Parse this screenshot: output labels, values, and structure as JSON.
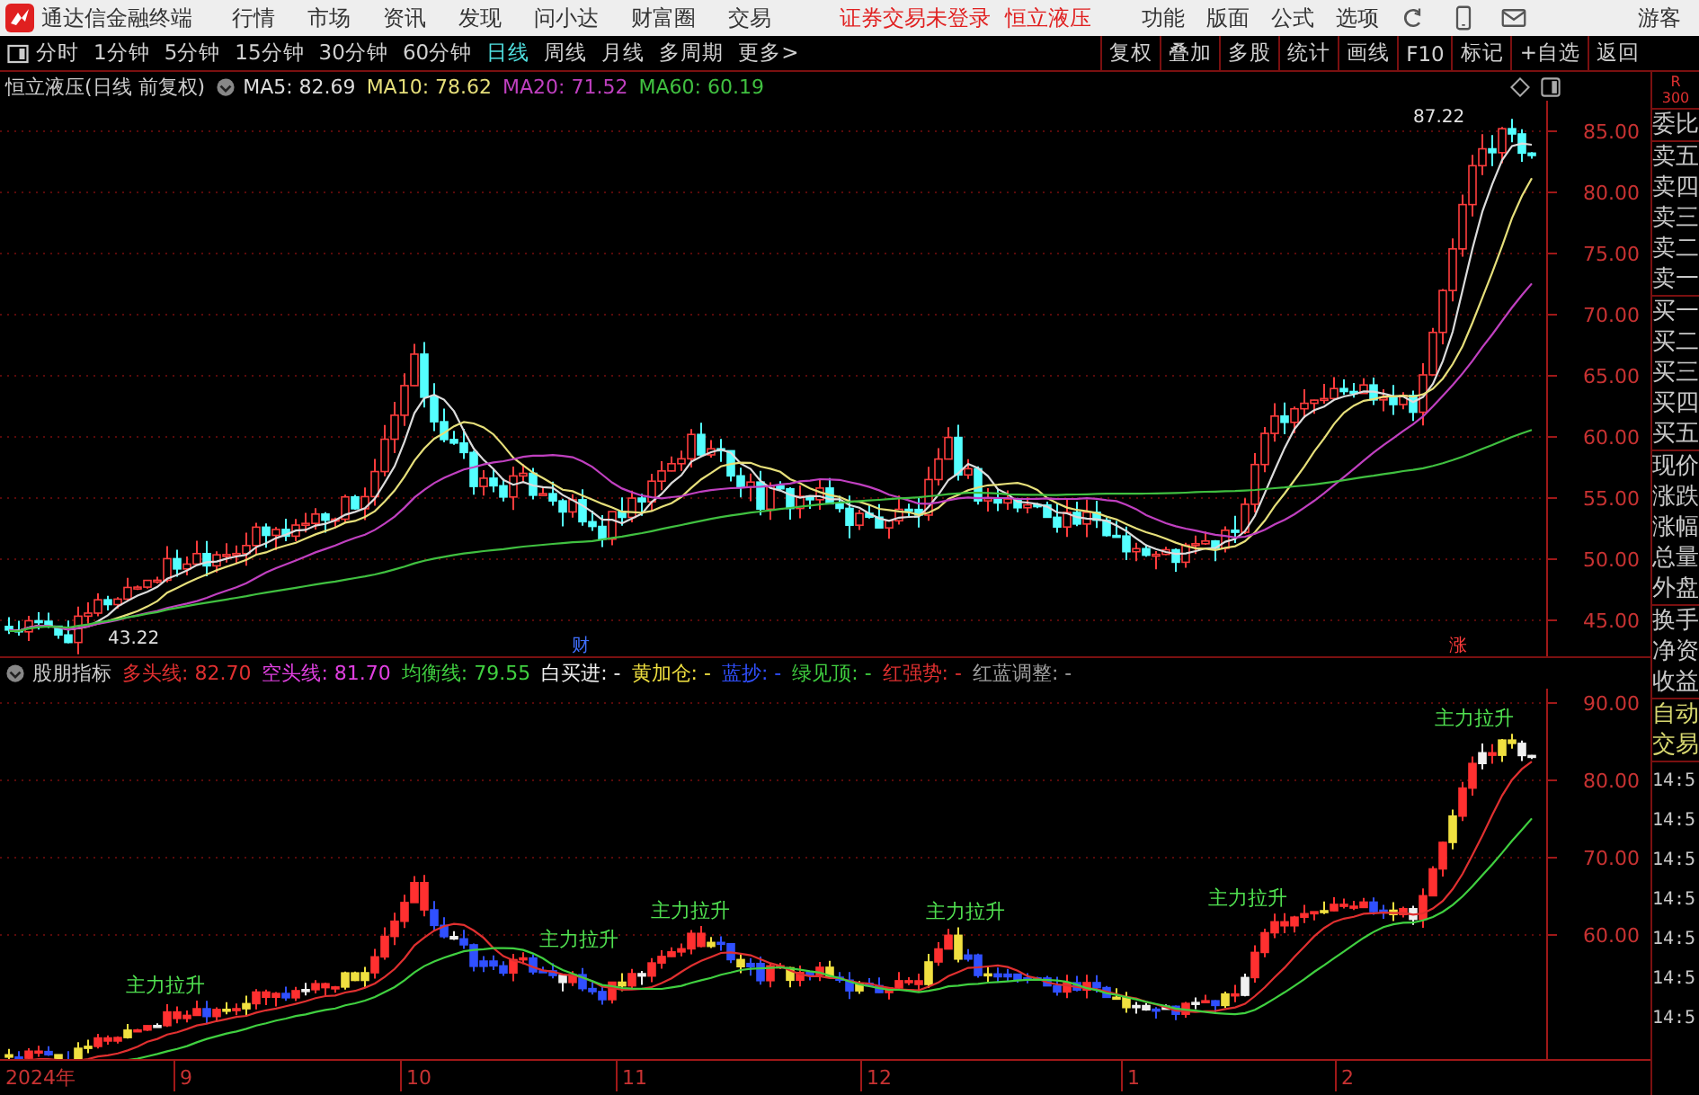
{
  "title_bar": {
    "app_name": "通达信金融终端",
    "menus": [
      "行情",
      "市场",
      "资讯",
      "发现",
      "问小达",
      "财富圈",
      "交易"
    ],
    "notices": [
      "证券交易未登录",
      "恒立液压"
    ],
    "right_menus": [
      "功能",
      "版面",
      "公式",
      "选项"
    ],
    "user": "游客"
  },
  "toolbar": {
    "periods": [
      {
        "label": "分时",
        "selected": false
      },
      {
        "label": "1分钟",
        "selected": false
      },
      {
        "label": "5分钟",
        "selected": false
      },
      {
        "label": "15分钟",
        "selected": false
      },
      {
        "label": "30分钟",
        "selected": false
      },
      {
        "label": "60分钟",
        "selected": false
      },
      {
        "label": "日线",
        "selected": true
      },
      {
        "label": "周线",
        "selected": false
      },
      {
        "label": "月线",
        "selected": false
      },
      {
        "label": "多周期",
        "selected": false
      },
      {
        "label": "更多>",
        "selected": false
      }
    ],
    "actions": [
      "复权",
      "叠加",
      "多股",
      "统计",
      "画线",
      "F10",
      "标记",
      "+自选",
      "返回"
    ]
  },
  "price_chart": {
    "legend_title": "恒立液压(日线 前复权)",
    "averages": [
      {
        "label": "MA5: 82.69",
        "color": "#dcdcdc"
      },
      {
        "label": "MA10: 78.62",
        "color": "#e6df7a"
      },
      {
        "label": "MA20: 71.52",
        "color": "#c040c0"
      },
      {
        "label": "MA60: 60.19",
        "color": "#40c040"
      }
    ],
    "y_ticks": [
      "85.00",
      "80.00",
      "75.00",
      "70.00",
      "65.00",
      "60.00",
      "55.00",
      "50.00",
      "45.00"
    ],
    "annotations": [
      "87.22",
      "43.22",
      "财",
      "涨"
    ]
  },
  "indicator_chart": {
    "name": "股朋指标",
    "items": [
      {
        "label": "多头线: 82.70",
        "color": "#e03030"
      },
      {
        "label": "空头线: 81.70",
        "color": "#e040e0"
      },
      {
        "label": "均衡线: 79.55",
        "color": "#40d040"
      },
      {
        "label": "白买进: -",
        "color": "#f0f0f0"
      },
      {
        "label": "黄加仓: -",
        "color": "#f0e040"
      },
      {
        "label": "蓝抄: -",
        "color": "#3050ff"
      },
      {
        "label": "绿见顶: -",
        "color": "#40d040"
      },
      {
        "label": "红强势: -",
        "color": "#e03030"
      },
      {
        "label": "红蓝调整: -",
        "color": "#a0a0a0"
      }
    ],
    "y_ticks": [
      "90.00",
      "80.00",
      "70.00",
      "60.00"
    ],
    "annotations": [
      "主力拉升",
      "主力拉升",
      "主力拉升",
      "主力拉升",
      "主力拉升",
      "主力拉升"
    ]
  },
  "x_axis": {
    "labels": [
      "2024年",
      "9",
      "10",
      "11",
      "12",
      "1",
      "2"
    ]
  },
  "quote_panel": {
    "badge": [
      "R",
      "300"
    ],
    "groups": [
      {
        "kind": "ratio",
        "labels": [
          "委比"
        ]
      },
      {
        "kind": "book",
        "labels": [
          "卖五",
          "卖四",
          "卖三",
          "卖二",
          "卖一"
        ]
      },
      {
        "kind": "book",
        "labels": [
          "买一",
          "买二",
          "买三",
          "买四",
          "买五"
        ]
      },
      {
        "kind": "stats",
        "labels": [
          "现价",
          "涨跌",
          "涨幅",
          "总量",
          "外盘"
        ]
      },
      {
        "kind": "stats",
        "labels": [
          "换手",
          "净资",
          "收益"
        ]
      },
      {
        "kind": "mode",
        "labels": [
          "自动",
          "交易"
        ]
      }
    ],
    "times": [
      "14:5",
      "14:5",
      "14:5",
      "14:5",
      "14:5",
      "14:5",
      "14:5"
    ]
  }
}
